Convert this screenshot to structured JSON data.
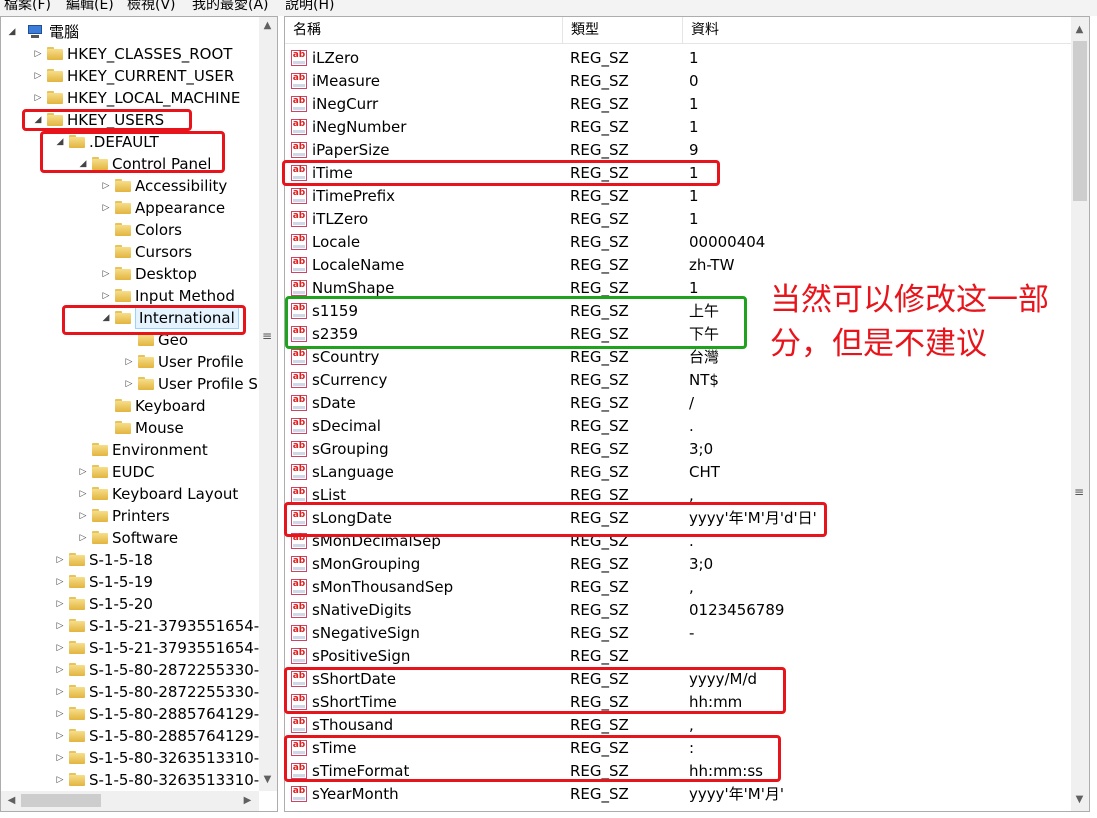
{
  "menu": [
    "檔案(F)",
    "編輯(E)",
    "檢視(V)",
    "我的最愛(A)",
    "說明(H)"
  ],
  "tree": [
    {
      "label": "電腦",
      "arrow": "◢",
      "depth": 0,
      "kind": "computer"
    },
    {
      "label": "HKEY_CLASSES_ROOT",
      "arrow": "▷",
      "depth": 1
    },
    {
      "label": "HKEY_CURRENT_USER",
      "arrow": "▷",
      "depth": 1
    },
    {
      "label": "HKEY_LOCAL_MACHINE",
      "arrow": "▷",
      "depth": 1
    },
    {
      "label": "HKEY_USERS",
      "arrow": "◢",
      "depth": 1
    },
    {
      "label": ".DEFAULT",
      "arrow": "◢",
      "depth": 2
    },
    {
      "label": "Control Panel",
      "arrow": "◢",
      "depth": 3
    },
    {
      "label": "Accessibility",
      "arrow": "▷",
      "depth": 4
    },
    {
      "label": "Appearance",
      "arrow": "▷",
      "depth": 4
    },
    {
      "label": "Colors",
      "arrow": "",
      "depth": 4
    },
    {
      "label": "Cursors",
      "arrow": "",
      "depth": 4
    },
    {
      "label": "Desktop",
      "arrow": "▷",
      "depth": 4
    },
    {
      "label": "Input Method",
      "arrow": "▷",
      "depth": 4
    },
    {
      "label": "International",
      "arrow": "◢",
      "depth": 4,
      "selected": true
    },
    {
      "label": "Geo",
      "arrow": "",
      "depth": 5
    },
    {
      "label": "User Profile",
      "arrow": "▷",
      "depth": 5
    },
    {
      "label": "User Profile S",
      "arrow": "▷",
      "depth": 5
    },
    {
      "label": "Keyboard",
      "arrow": "",
      "depth": 4
    },
    {
      "label": "Mouse",
      "arrow": "",
      "depth": 4
    },
    {
      "label": "Environment",
      "arrow": "",
      "depth": 3
    },
    {
      "label": "EUDC",
      "arrow": "▷",
      "depth": 3
    },
    {
      "label": "Keyboard Layout",
      "arrow": "▷",
      "depth": 3
    },
    {
      "label": "Printers",
      "arrow": "▷",
      "depth": 3
    },
    {
      "label": "Software",
      "arrow": "▷",
      "depth": 3
    },
    {
      "label": "S-1-5-18",
      "arrow": "▷",
      "depth": 2
    },
    {
      "label": "S-1-5-19",
      "arrow": "▷",
      "depth": 2
    },
    {
      "label": "S-1-5-20",
      "arrow": "▷",
      "depth": 2
    },
    {
      "label": "S-1-5-21-3793551654-",
      "arrow": "▷",
      "depth": 2
    },
    {
      "label": "S-1-5-21-3793551654-",
      "arrow": "▷",
      "depth": 2
    },
    {
      "label": "S-1-5-80-2872255330-",
      "arrow": "▷",
      "depth": 2
    },
    {
      "label": "S-1-5-80-2872255330-",
      "arrow": "▷",
      "depth": 2
    },
    {
      "label": "S-1-5-80-2885764129-",
      "arrow": "▷",
      "depth": 2
    },
    {
      "label": "S-1-5-80-2885764129-",
      "arrow": "▷",
      "depth": 2
    },
    {
      "label": "S-1-5-80-3263513310-",
      "arrow": "▷",
      "depth": 2
    },
    {
      "label": "S-1-5-80-3263513310-",
      "arrow": "▷",
      "depth": 2
    }
  ],
  "columns": {
    "name": "名稱",
    "type": "類型",
    "data": "資料"
  },
  "values": [
    {
      "name": "iLZero",
      "type": "REG_SZ",
      "data": "1"
    },
    {
      "name": "iMeasure",
      "type": "REG_SZ",
      "data": "0"
    },
    {
      "name": "iNegCurr",
      "type": "REG_SZ",
      "data": "1"
    },
    {
      "name": "iNegNumber",
      "type": "REG_SZ",
      "data": "1"
    },
    {
      "name": "iPaperSize",
      "type": "REG_SZ",
      "data": "9"
    },
    {
      "name": "iTime",
      "type": "REG_SZ",
      "data": "1"
    },
    {
      "name": "iTimePrefix",
      "type": "REG_SZ",
      "data": "1"
    },
    {
      "name": "iTLZero",
      "type": "REG_SZ",
      "data": "1"
    },
    {
      "name": "Locale",
      "type": "REG_SZ",
      "data": "00000404"
    },
    {
      "name": "LocaleName",
      "type": "REG_SZ",
      "data": "zh-TW"
    },
    {
      "name": "NumShape",
      "type": "REG_SZ",
      "data": "1"
    },
    {
      "name": "s1159",
      "type": "REG_SZ",
      "data": "上午"
    },
    {
      "name": "s2359",
      "type": "REG_SZ",
      "data": "下午"
    },
    {
      "name": "sCountry",
      "type": "REG_SZ",
      "data": "台灣"
    },
    {
      "name": "sCurrency",
      "type": "REG_SZ",
      "data": "NT$"
    },
    {
      "name": "sDate",
      "type": "REG_SZ",
      "data": "/"
    },
    {
      "name": "sDecimal",
      "type": "REG_SZ",
      "data": "."
    },
    {
      "name": "sGrouping",
      "type": "REG_SZ",
      "data": "3;0"
    },
    {
      "name": "sLanguage",
      "type": "REG_SZ",
      "data": "CHT"
    },
    {
      "name": "sList",
      "type": "REG_SZ",
      "data": ","
    },
    {
      "name": "sLongDate",
      "type": "REG_SZ",
      "data": "yyyy'年'M'月'd'日'"
    },
    {
      "name": "sMonDecimalSep",
      "type": "REG_SZ",
      "data": "."
    },
    {
      "name": "sMonGrouping",
      "type": "REG_SZ",
      "data": "3;0"
    },
    {
      "name": "sMonThousandSep",
      "type": "REG_SZ",
      "data": ","
    },
    {
      "name": "sNativeDigits",
      "type": "REG_SZ",
      "data": "0123456789"
    },
    {
      "name": "sNegativeSign",
      "type": "REG_SZ",
      "data": "-"
    },
    {
      "name": "sPositiveSign",
      "type": "REG_SZ",
      "data": ""
    },
    {
      "name": "sShortDate",
      "type": "REG_SZ",
      "data": "yyyy/M/d"
    },
    {
      "name": "sShortTime",
      "type": "REG_SZ",
      "data": "hh:mm"
    },
    {
      "name": "sThousand",
      "type": "REG_SZ",
      "data": ","
    },
    {
      "name": "sTime",
      "type": "REG_SZ",
      "data": ":"
    },
    {
      "name": "sTimeFormat",
      "type": "REG_SZ",
      "data": "hh:mm:ss"
    },
    {
      "name": "sYearMonth",
      "type": "REG_SZ",
      "data": "yyyy'年'M'月'"
    }
  ],
  "value_icon_text": "ab",
  "annotation": "当然可以修改这一部分，但是不建议",
  "colors": {
    "highlight_red": "#e8141b",
    "highlight_green": "#1fa31f",
    "selection": "#e5f3ff"
  }
}
